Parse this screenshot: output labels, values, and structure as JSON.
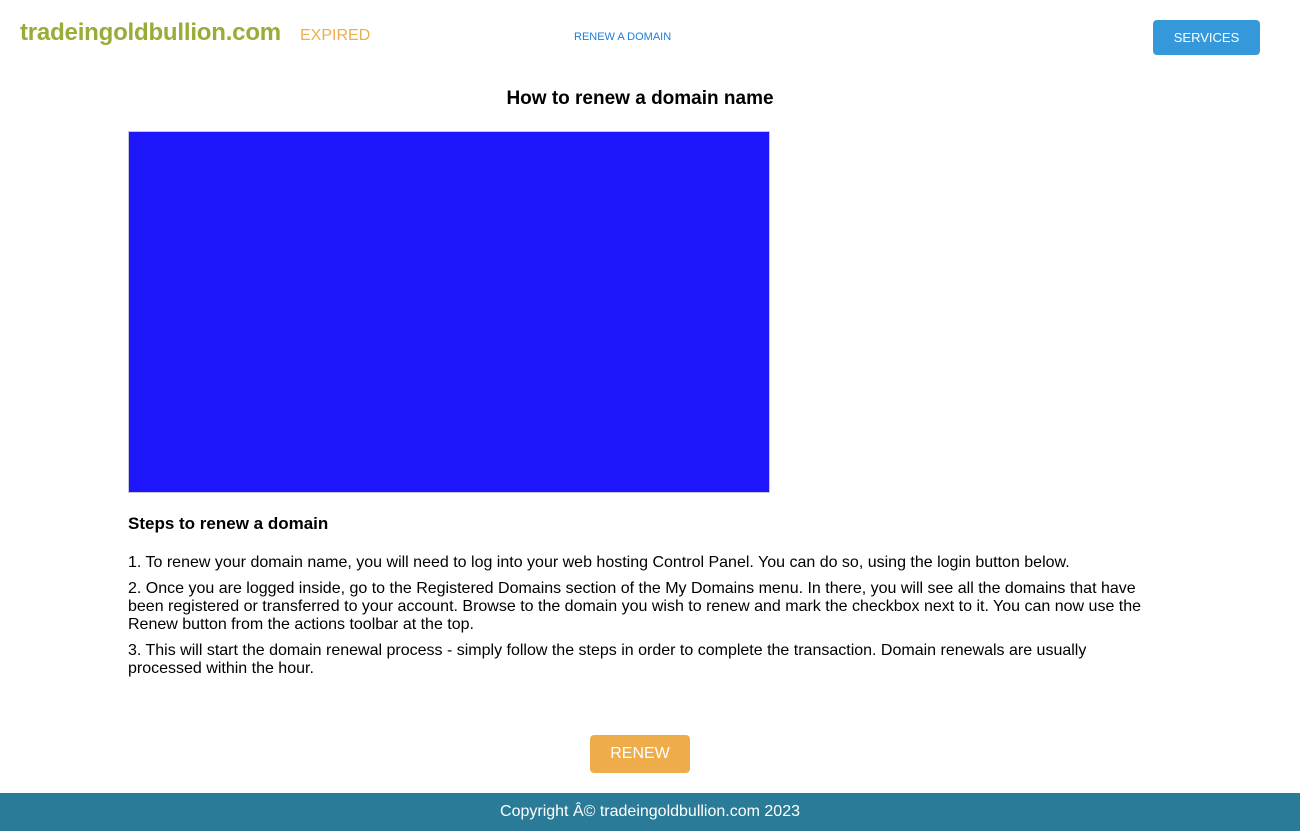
{
  "header": {
    "site_name": "tradeingoldbullion.com",
    "status": "EXPIRED",
    "renew_link": "RENEW A DOMAIN",
    "services_label": "SERVICES"
  },
  "main": {
    "title": "How to renew a domain name",
    "steps_title": "Steps to renew a domain",
    "steps": [
      "1. To renew your domain name, you will need to log into your web hosting Control Panel. You can do so, using the login button below.",
      "2. Once you are logged inside, go to the Registered Domains section of the My Domains menu. In there, you will see all the domains that have been registered or transferred to your account. Browse to the domain you wish to renew and mark the checkbox next to it. You can now use the Renew button from the actions toolbar at the top.",
      "3. This will start the domain renewal process - simply follow the steps in order to complete the transaction. Domain renewals are usually processed within the hour."
    ],
    "renew_label": "RENEW"
  },
  "footer": {
    "copyright": "Copyright Â© tradeingoldbullion.com 2023"
  },
  "colors": {
    "brand_green": "#9aab37",
    "expired_orange": "#eead4a",
    "link_blue": "#1a7fd9",
    "services_blue": "#3598db",
    "video_blue": "#1e16fa",
    "footer_teal": "#2a7b97"
  }
}
